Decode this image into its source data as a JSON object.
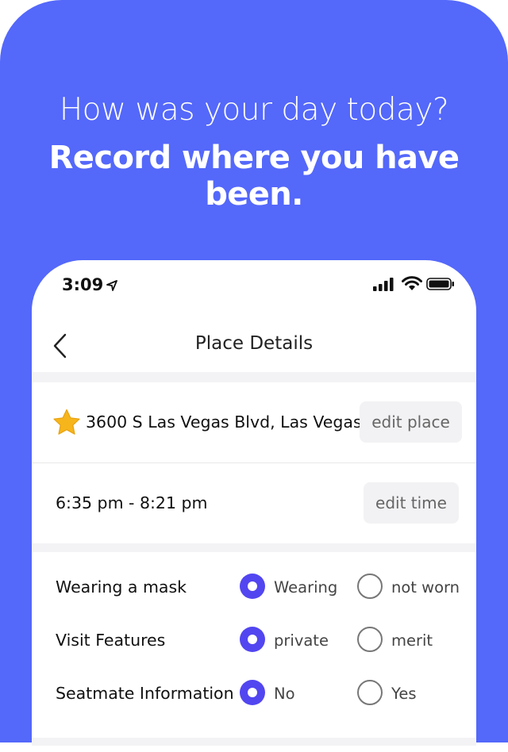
{
  "banner": {
    "headline": "How was your day today?",
    "subheadline": "Record where you have been."
  },
  "status_bar": {
    "time": "3:09",
    "icons": [
      "location-arrow-icon",
      "cellular-signal-icon",
      "wifi-icon",
      "battery-icon"
    ]
  },
  "nav": {
    "title": "Place Details",
    "back_icon": "chevron-left-icon"
  },
  "place": {
    "icon": "star-icon",
    "name": "3600 S Las Vegas Blvd, Las Vegas",
    "edit_label": "edit place"
  },
  "visit_time": {
    "range": "6:35 pm - 8:21 pm",
    "edit_label": "edit time"
  },
  "options": [
    {
      "label": "Wearing a mask",
      "choice_a": "Wearing",
      "choice_b": "not worn",
      "selected": "a"
    },
    {
      "label": "Visit Features",
      "choice_a": "private",
      "choice_b": "merit",
      "selected": "a"
    },
    {
      "label": "Seatmate Information",
      "choice_a": "No",
      "choice_b": "Yes",
      "selected": "a"
    }
  ],
  "colors": {
    "background": "#5468fa",
    "accent": "#5246f0",
    "star": "#f7b51c"
  }
}
